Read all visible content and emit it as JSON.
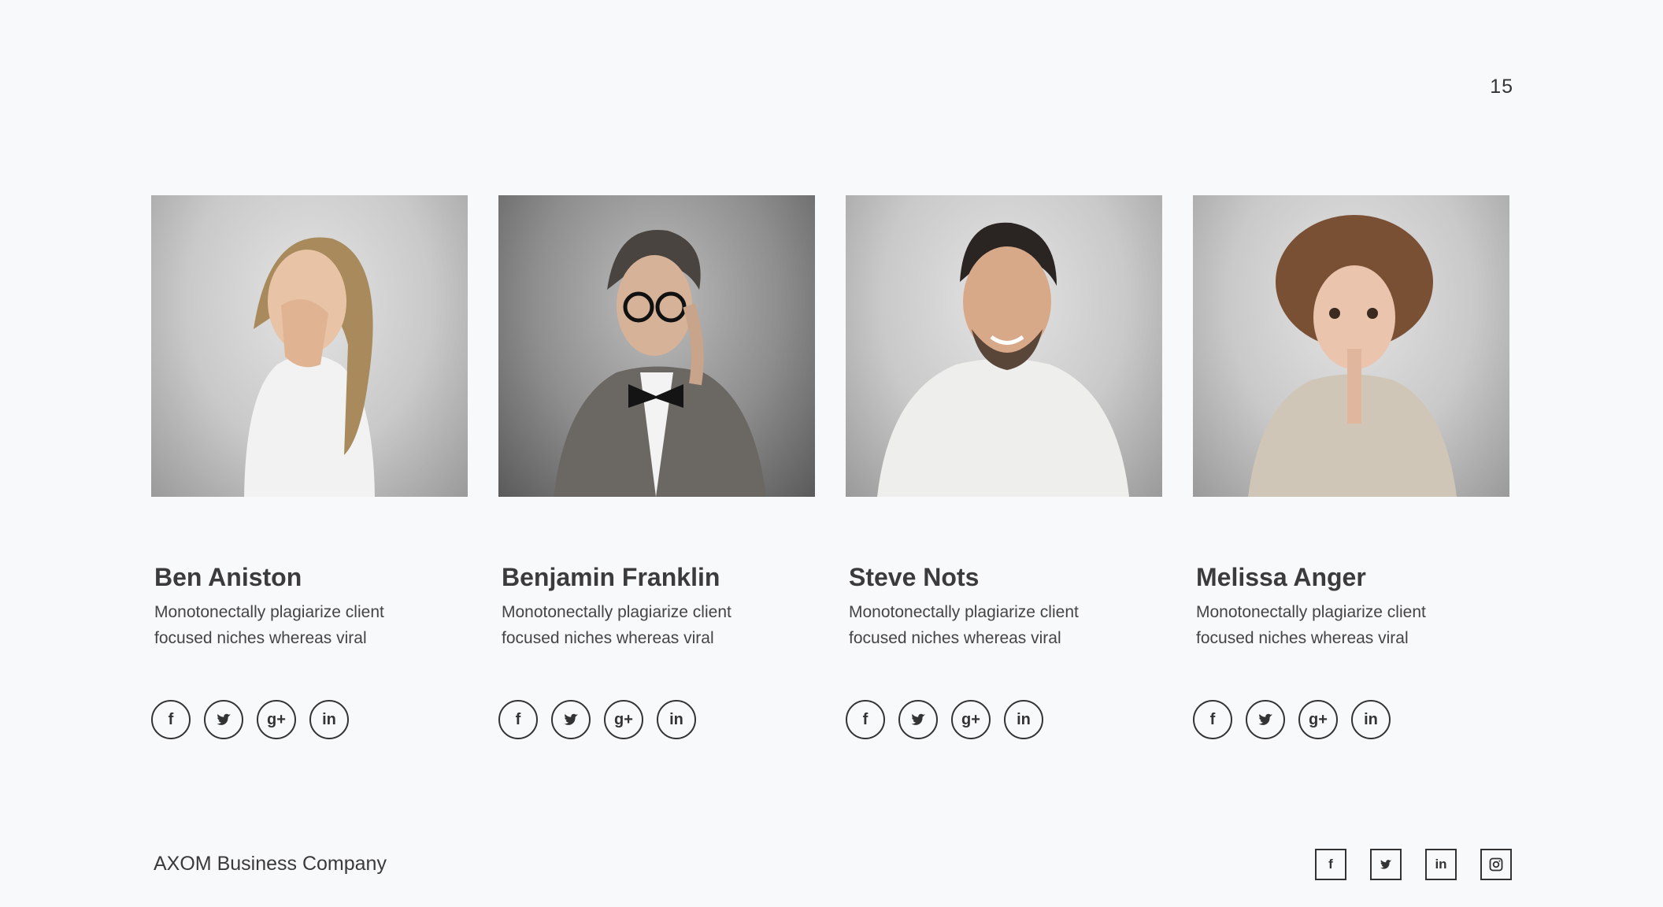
{
  "page_number": "15",
  "members": [
    {
      "name": "Ben Aniston",
      "bio": "Monotonectally plagiarize client focused niches whereas viral"
    },
    {
      "name": "Benjamin Franklin",
      "bio": "Monotonectally plagiarize client focused niches whereas viral"
    },
    {
      "name": "Steve Nots",
      "bio": "Monotonectally plagiarize client focused niches whereas viral"
    },
    {
      "name": "Melissa Anger",
      "bio": "Monotonectally plagiarize client focused niches whereas viral"
    }
  ],
  "icons": {
    "facebook": "f",
    "twitter": "🐦",
    "googleplus": "g+",
    "linkedin": "in",
    "instagram": "◎"
  },
  "footer": {
    "brand": "AXOM Business Company"
  }
}
